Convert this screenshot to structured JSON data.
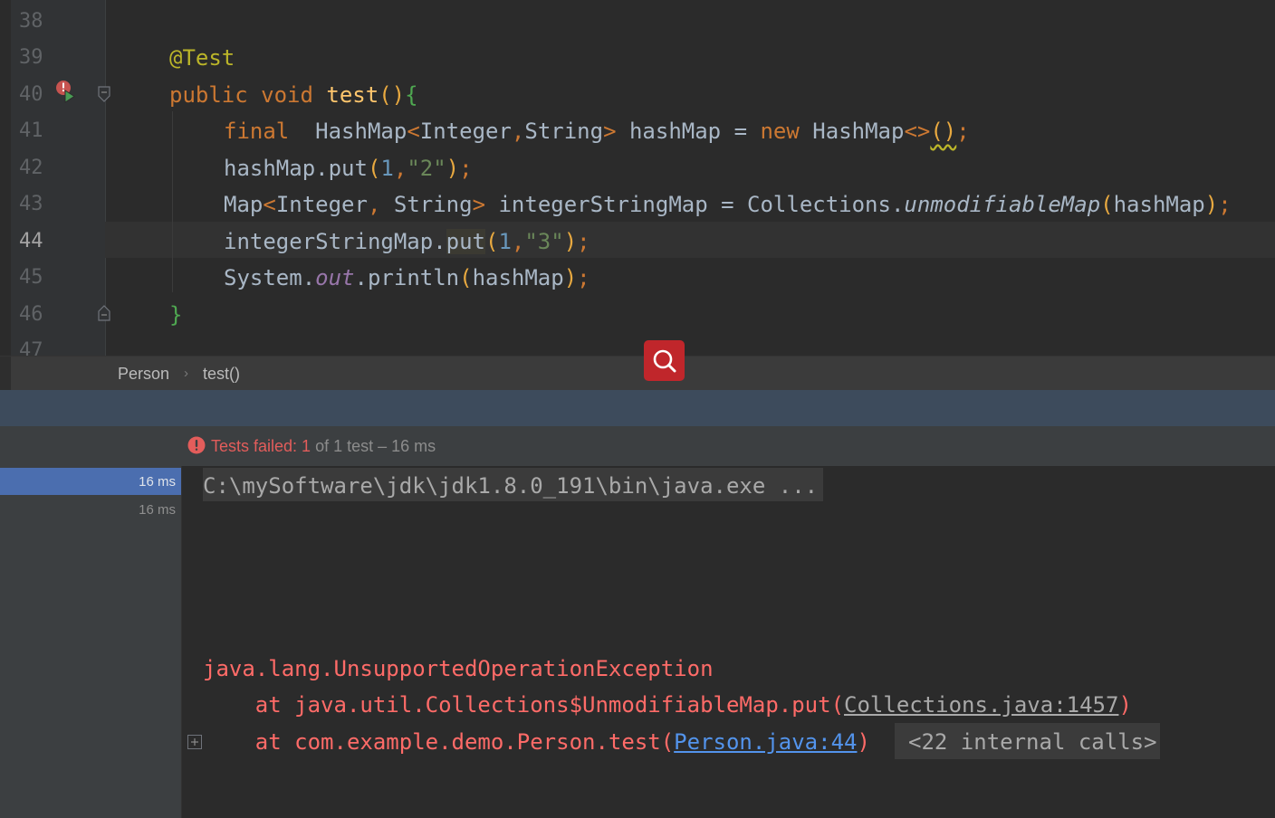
{
  "editor": {
    "lines": [
      {
        "num": "38"
      },
      {
        "num": "39"
      },
      {
        "num": "40"
      },
      {
        "num": "41"
      },
      {
        "num": "42"
      },
      {
        "num": "43"
      },
      {
        "num": "44"
      },
      {
        "num": "45"
      },
      {
        "num": "46"
      },
      {
        "num": "47"
      }
    ],
    "code": {
      "l39_annotation": "@Test",
      "l40_public": "public",
      "l40_void": "void",
      "l40_name": "test",
      "l40_parens": "()",
      "l40_brace": "{",
      "l41_final": "final",
      "l41_type": "HashMap",
      "l41_lt": "<",
      "l41_t1": "Integer",
      "l41_comma": ",",
      "l41_t2": "String",
      "l41_gt": ">",
      "l41_assign": " hashMap = ",
      "l41_new": "new",
      "l41_ctor": " HashMap",
      "l41_diamond": "<>",
      "l41_call": "()",
      "l41_semi": ";",
      "l42_recv": "hashMap.put",
      "l42_po": "(",
      "l42_num": "1",
      "l42_comma": ",",
      "l42_str": "\"2\"",
      "l42_pc": ")",
      "l42_semi": ";",
      "l43_type": "Map",
      "l43_lt": "<",
      "l43_t1": "Integer",
      "l43_comma": ", ",
      "l43_t2": "String",
      "l43_gt": ">",
      "l43_mid": " integerStringMap = Collections.",
      "l43_method": "unmodifiableMap",
      "l43_po": "(",
      "l43_arg": "hashMap",
      "l43_pc": ")",
      "l43_semi": ";",
      "l44_recv": "integerStringMap.",
      "l44_method": "put",
      "l44_po": "(",
      "l44_num": "1",
      "l44_comma": ",",
      "l44_str": "\"3\"",
      "l44_pc": ")",
      "l44_semi": ";",
      "l45_sys": "System.",
      "l45_out": "out",
      "l45_call": ".println",
      "l45_po": "(",
      "l45_arg": "hashMap",
      "l45_pc": ")",
      "l45_semi": ";",
      "l46_brace": "}"
    }
  },
  "breadcrumb": {
    "class_name": "Person",
    "separator": "›",
    "method_name": "test()"
  },
  "run": {
    "status_failed": "Tests failed: 1",
    "status_rest": " of 1 test – 16 ms",
    "tree": [
      {
        "time": "16 ms"
      },
      {
        "time": "16 ms"
      }
    ],
    "console": {
      "command": "C:\\mySoftware\\jdk\\jdk1.8.0_191\\bin\\java.exe ...",
      "exception": "java.lang.UnsupportedOperationException",
      "frame1_prefix": "    at java.util.Collections$UnmodifiableMap.put(",
      "frame1_link": "Collections.java:1457",
      "frame1_suffix": ")",
      "frame2_prefix": "    at com.example.demo.Person.test(",
      "frame2_link": "Person.java:44",
      "frame2_suffix": ")",
      "internal_calls": "<22 internal calls>"
    }
  },
  "colors": {
    "editor_bg": "#2b2b2b",
    "keyword": "#cc7832",
    "annotation": "#bbb529",
    "function": "#ffc66d",
    "string": "#6a8759",
    "number": "#6897bb",
    "error_text": "#ff6b68",
    "link": "#5394ec",
    "selection": "#4b6eaf",
    "search_button": "#c0262b"
  },
  "icons": [
    "breakpoint-run-icon",
    "fold-icon",
    "search-icon",
    "error-icon",
    "expand-icon"
  ]
}
